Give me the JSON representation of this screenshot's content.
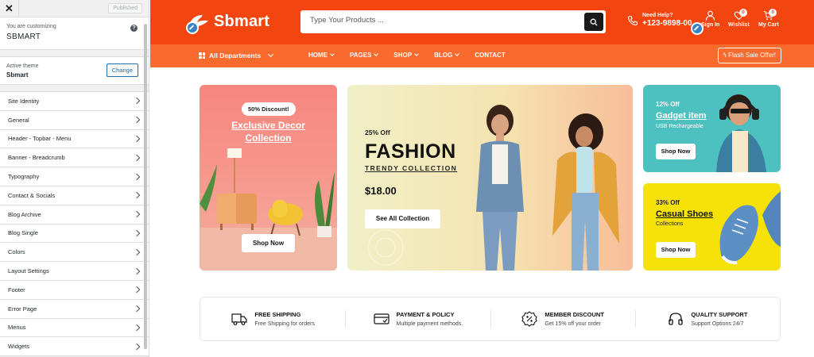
{
  "customizer": {
    "close_glyph": "✕",
    "publish_label": "Published",
    "info_label": "You are customizing",
    "site_name": "SBMART",
    "help_glyph": "?",
    "active_theme_label": "Active theme",
    "theme_name": "Sbmart",
    "change_button": "Change",
    "sections": [
      "Site Identity",
      "General",
      "Header - Topbar - Menu",
      "Banner - Breadcrumb",
      "Typography",
      "Contact & Socials",
      "Blog Archive",
      "Blog Single",
      "Colors",
      "Layout Settings",
      "Footer",
      "Error Page",
      "Menus",
      "Widgets"
    ]
  },
  "header": {
    "logo_text": "Sbmart",
    "search_placeholder": "Type Your Products ...",
    "help_label": "Need Help?",
    "help_phone": "+123-9898-00",
    "signin_label": "Sign In",
    "wishlist_label": "Wishlist",
    "wishlist_count": "0",
    "cart_label": "My Cart",
    "cart_count": "0",
    "brand_color": "#f2450f"
  },
  "nav": {
    "departments_label": "All Departments",
    "links": [
      "HOME",
      "PAGES",
      "SHOP",
      "BLOG",
      "CONTACT"
    ],
    "flash_label": "Flash Sale Offer!"
  },
  "banners": {
    "left": {
      "badge": "50% Discount!",
      "title_line1": "Exclusive Decor",
      "title_line2": "Collection",
      "button": "Shop Now"
    },
    "center": {
      "offer": "25% Off",
      "title": "FASHION",
      "subtitle": "TRENDY COLLECTION",
      "price": "$18.00",
      "button": "See All Collection"
    },
    "right_top": {
      "offer": "12% Off",
      "title": "Gadget item",
      "subtitle": "USB Rechargeable",
      "button": "Shop Now"
    },
    "right_bottom": {
      "offer": "33% Off",
      "title": "Casual Shoes",
      "subtitle": "Collections",
      "button": "Shop Now"
    }
  },
  "features": [
    {
      "title": "FREE SHIPPING",
      "subtitle": "Free Shipping for orders",
      "icon": "truck-icon"
    },
    {
      "title": "PAYMENT & POLICY",
      "subtitle": "Multiple payment methods.",
      "icon": "card-icon"
    },
    {
      "title": "MEMBER DISCOUNT",
      "subtitle": "Get 15% off your order",
      "icon": "discount-icon"
    },
    {
      "title": "QUALITY SUPPORT",
      "subtitle": "Support Options 24/7",
      "icon": "headphones-icon"
    }
  ]
}
